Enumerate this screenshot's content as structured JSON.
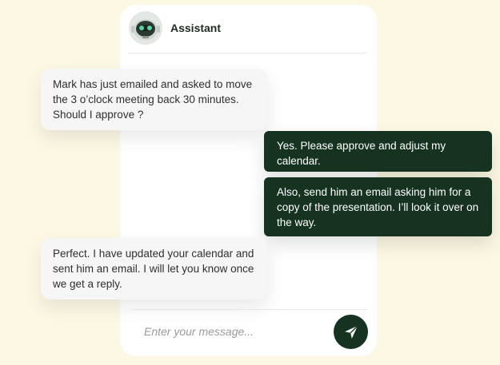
{
  "header": {
    "assistant_name": "Assistant",
    "avatar_icon": "robot-avatar-icon"
  },
  "messages": [
    {
      "sender": "assistant",
      "text": "Mark has just emailed and asked to move the 3 o’clock meeting back 30 minutes. Should I approve ?"
    },
    {
      "sender": "user",
      "text": "Yes. Please approve and adjust my calendar."
    },
    {
      "sender": "user",
      "text": "Also, send him an email asking him for a copy of the presentation. I’ll look it over on the way."
    },
    {
      "sender": "assistant",
      "text": "Perfect. I have updated your calendar and sent him an email. I will let you know once we get a reply."
    }
  ],
  "composer": {
    "placeholder": "Enter your message...",
    "send_icon": "send-icon"
  },
  "colors": {
    "page_background": "#fdf8e4",
    "card_background": "#ffffff",
    "user_bubble": "#163322",
    "assistant_bubble": "#f6f6f6",
    "accent": "#163322"
  }
}
